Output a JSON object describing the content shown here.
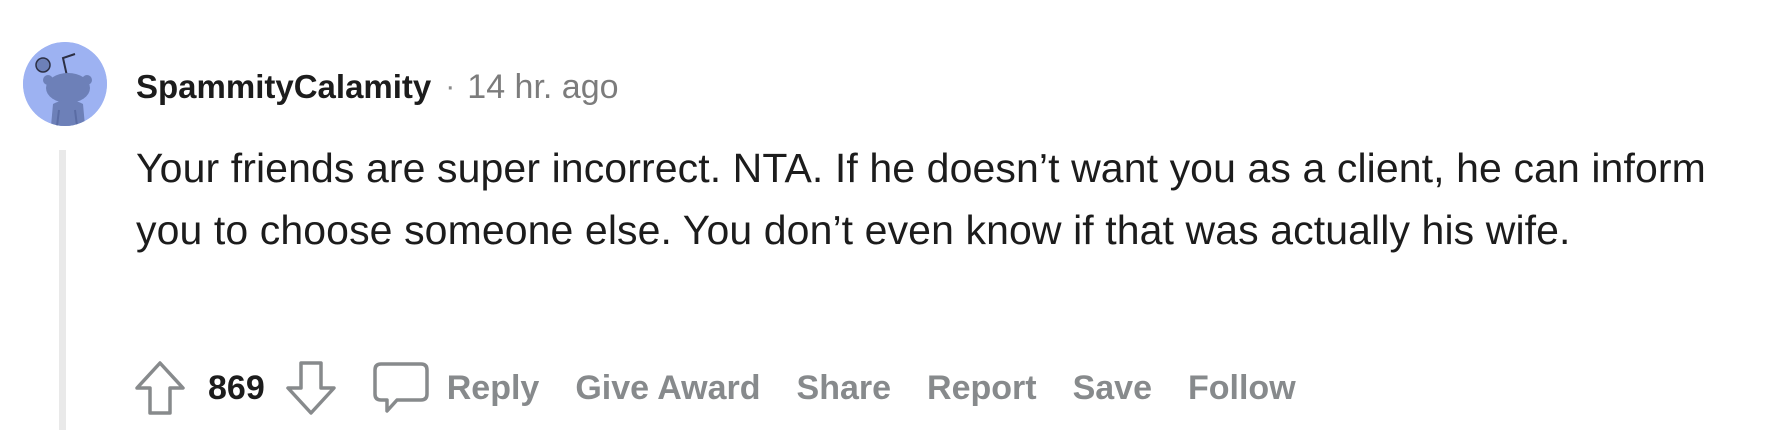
{
  "comment": {
    "username": "SpammityCalamity",
    "separator": "·",
    "timestamp": "14 hr. ago",
    "body": "Your friends are super incorrect. NTA. If he doesn’t want you as a client, he can inform you to choose someone else. You don’t even know if that was actually his wife.",
    "score": "869",
    "avatar_color": "#9db2f2"
  },
  "actions": {
    "reply": "Reply",
    "give_award": "Give Award",
    "share": "Share",
    "report": "Report",
    "save": "Save",
    "follow": "Follow"
  },
  "icons": {
    "upvote": "upvote-arrow-icon",
    "downvote": "downvote-arrow-icon",
    "comment": "speech-bubble-icon",
    "avatar": "snoo-avatar-icon"
  }
}
